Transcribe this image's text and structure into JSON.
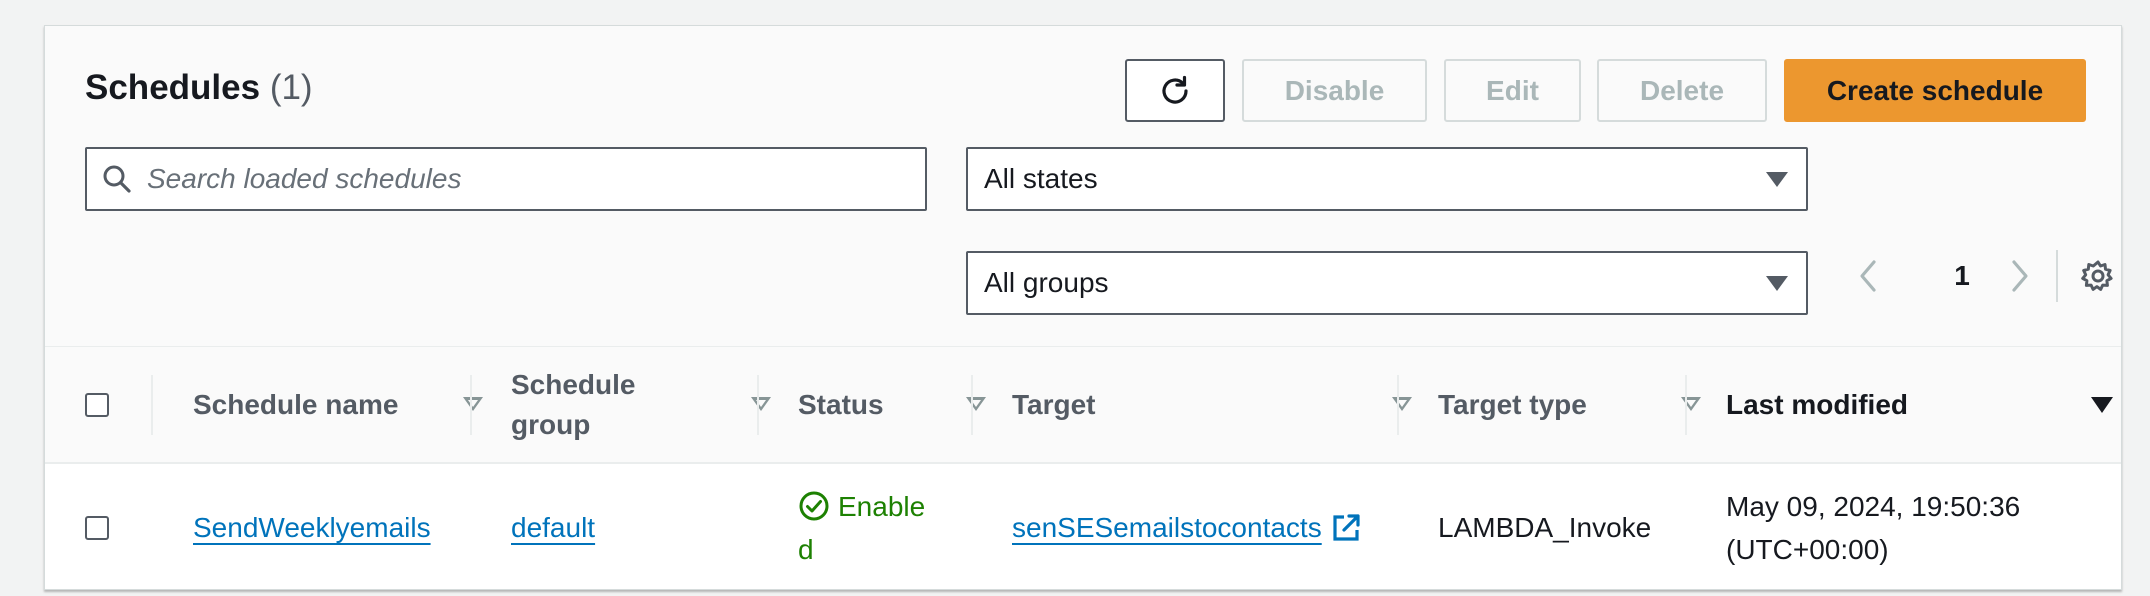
{
  "header": {
    "title": "Schedules",
    "count": "(1)"
  },
  "toolbar": {
    "refresh_icon": "refresh-icon",
    "disable_label": "Disable",
    "edit_label": "Edit",
    "delete_label": "Delete",
    "create_label": "Create schedule"
  },
  "search": {
    "placeholder": "Search loaded schedules"
  },
  "filters": {
    "state": "All states",
    "group": "All groups"
  },
  "pagination": {
    "page": "1"
  },
  "table": {
    "columns": [
      "Schedule name",
      "Schedule group",
      "Status",
      "Target",
      "Target type",
      "Last modified"
    ],
    "rows": [
      {
        "name": "SendWeeklyemails",
        "group": "default",
        "status_line1": "Enable",
        "status_line2": "d",
        "target": "senSESemailstocontacts",
        "target_type": "LAMBDA_Invoke",
        "modified_line1": "May 09, 2024, 19:50:36",
        "modified_line2": "(UTC+00:00)"
      }
    ]
  },
  "colors": {
    "primary": "#ec972f",
    "link": "#0073bb",
    "success": "#1d8102",
    "disabled_text": "#aab7b8"
  }
}
